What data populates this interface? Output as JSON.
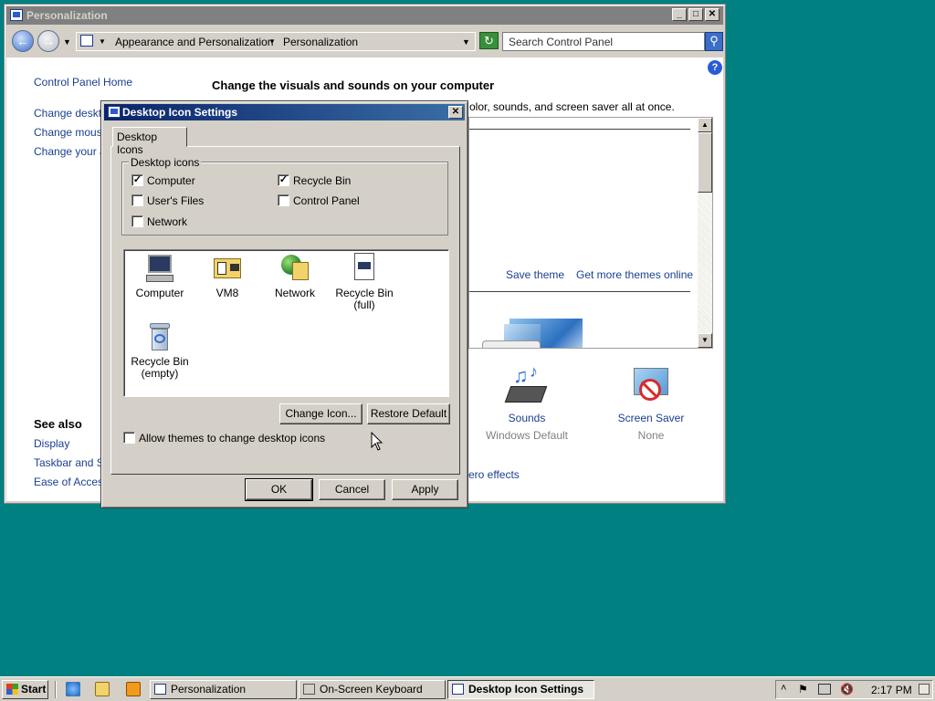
{
  "personalization_window": {
    "title": "Personalization",
    "buttons": {
      "minimize": "_",
      "maximize": "□",
      "close": "✕"
    },
    "breadcrumbs": [
      "Appearance and Personalization",
      "Personalization"
    ],
    "search_placeholder": "Search Control Panel",
    "sidebar": {
      "home": "Control Panel Home",
      "tasks": [
        "Change desktop",
        "Change mouse",
        "Change your ac"
      ],
      "see_also_heading": "See also",
      "see_also": [
        "Display",
        "Taskbar and Sta",
        "Ease of Access"
      ]
    },
    "heading": "Change the visuals and sounds on your computer",
    "subtitle": "olor, sounds, and screen saver all at once.",
    "theme_links": {
      "save": "Save theme",
      "get_more": "Get more themes online"
    },
    "settings": [
      {
        "label": "Sounds",
        "value": "Windows Default",
        "icon": "sounds-icon"
      },
      {
        "label": "Screen Saver",
        "value": "None",
        "icon": "screen-saver-icon"
      }
    ],
    "aero_link": "ero effects"
  },
  "dialog": {
    "title": "Desktop Icon Settings",
    "close": "✕",
    "tab": "Desktop Icons",
    "group_label": "Desktop icons",
    "checkboxes": [
      {
        "label": "Computer",
        "checked": true,
        "mark": "✓"
      },
      {
        "label": "Recycle Bin",
        "checked": true,
        "mark": "✓"
      },
      {
        "label": "User's Files",
        "checked": false,
        "mark": ""
      },
      {
        "label": "Control Panel",
        "checked": false,
        "mark": ""
      },
      {
        "label": "Network",
        "checked": false,
        "mark": ""
      }
    ],
    "icons": [
      {
        "line1": "Computer",
        "line2": "",
        "icon": "computer-icon"
      },
      {
        "line1": "VM8",
        "line2": "",
        "icon": "user-files-icon"
      },
      {
        "line1": "Network",
        "line2": "",
        "icon": "network-icon"
      },
      {
        "line1": "Recycle Bin",
        "line2": "(full)",
        "icon": "recycle-bin-full-icon"
      },
      {
        "line1": "Recycle Bin",
        "line2": "(empty)",
        "icon": "recycle-bin-empty-icon"
      }
    ],
    "change_icon_button": "Change Icon...",
    "restore_default_button": "Restore Default",
    "allow_themes": {
      "label": "Allow themes to change desktop icons",
      "checked": false
    },
    "ok": "OK",
    "cancel": "Cancel",
    "apply": "Apply"
  },
  "taskbar": {
    "start": "Start",
    "quick_launch": [
      "internet-explorer-icon",
      "folder-icon",
      "media-player-icon"
    ],
    "tasks": [
      {
        "label": "Personalization",
        "active": false
      },
      {
        "label": "On-Screen Keyboard",
        "active": false
      },
      {
        "label": "Desktop Icon Settings",
        "active": true
      }
    ],
    "tray_icons": [
      "chevron-up-icon",
      "flag-icon",
      "network-tray-icon",
      "volume-muted-icon"
    ],
    "clock": "2:17 PM"
  }
}
